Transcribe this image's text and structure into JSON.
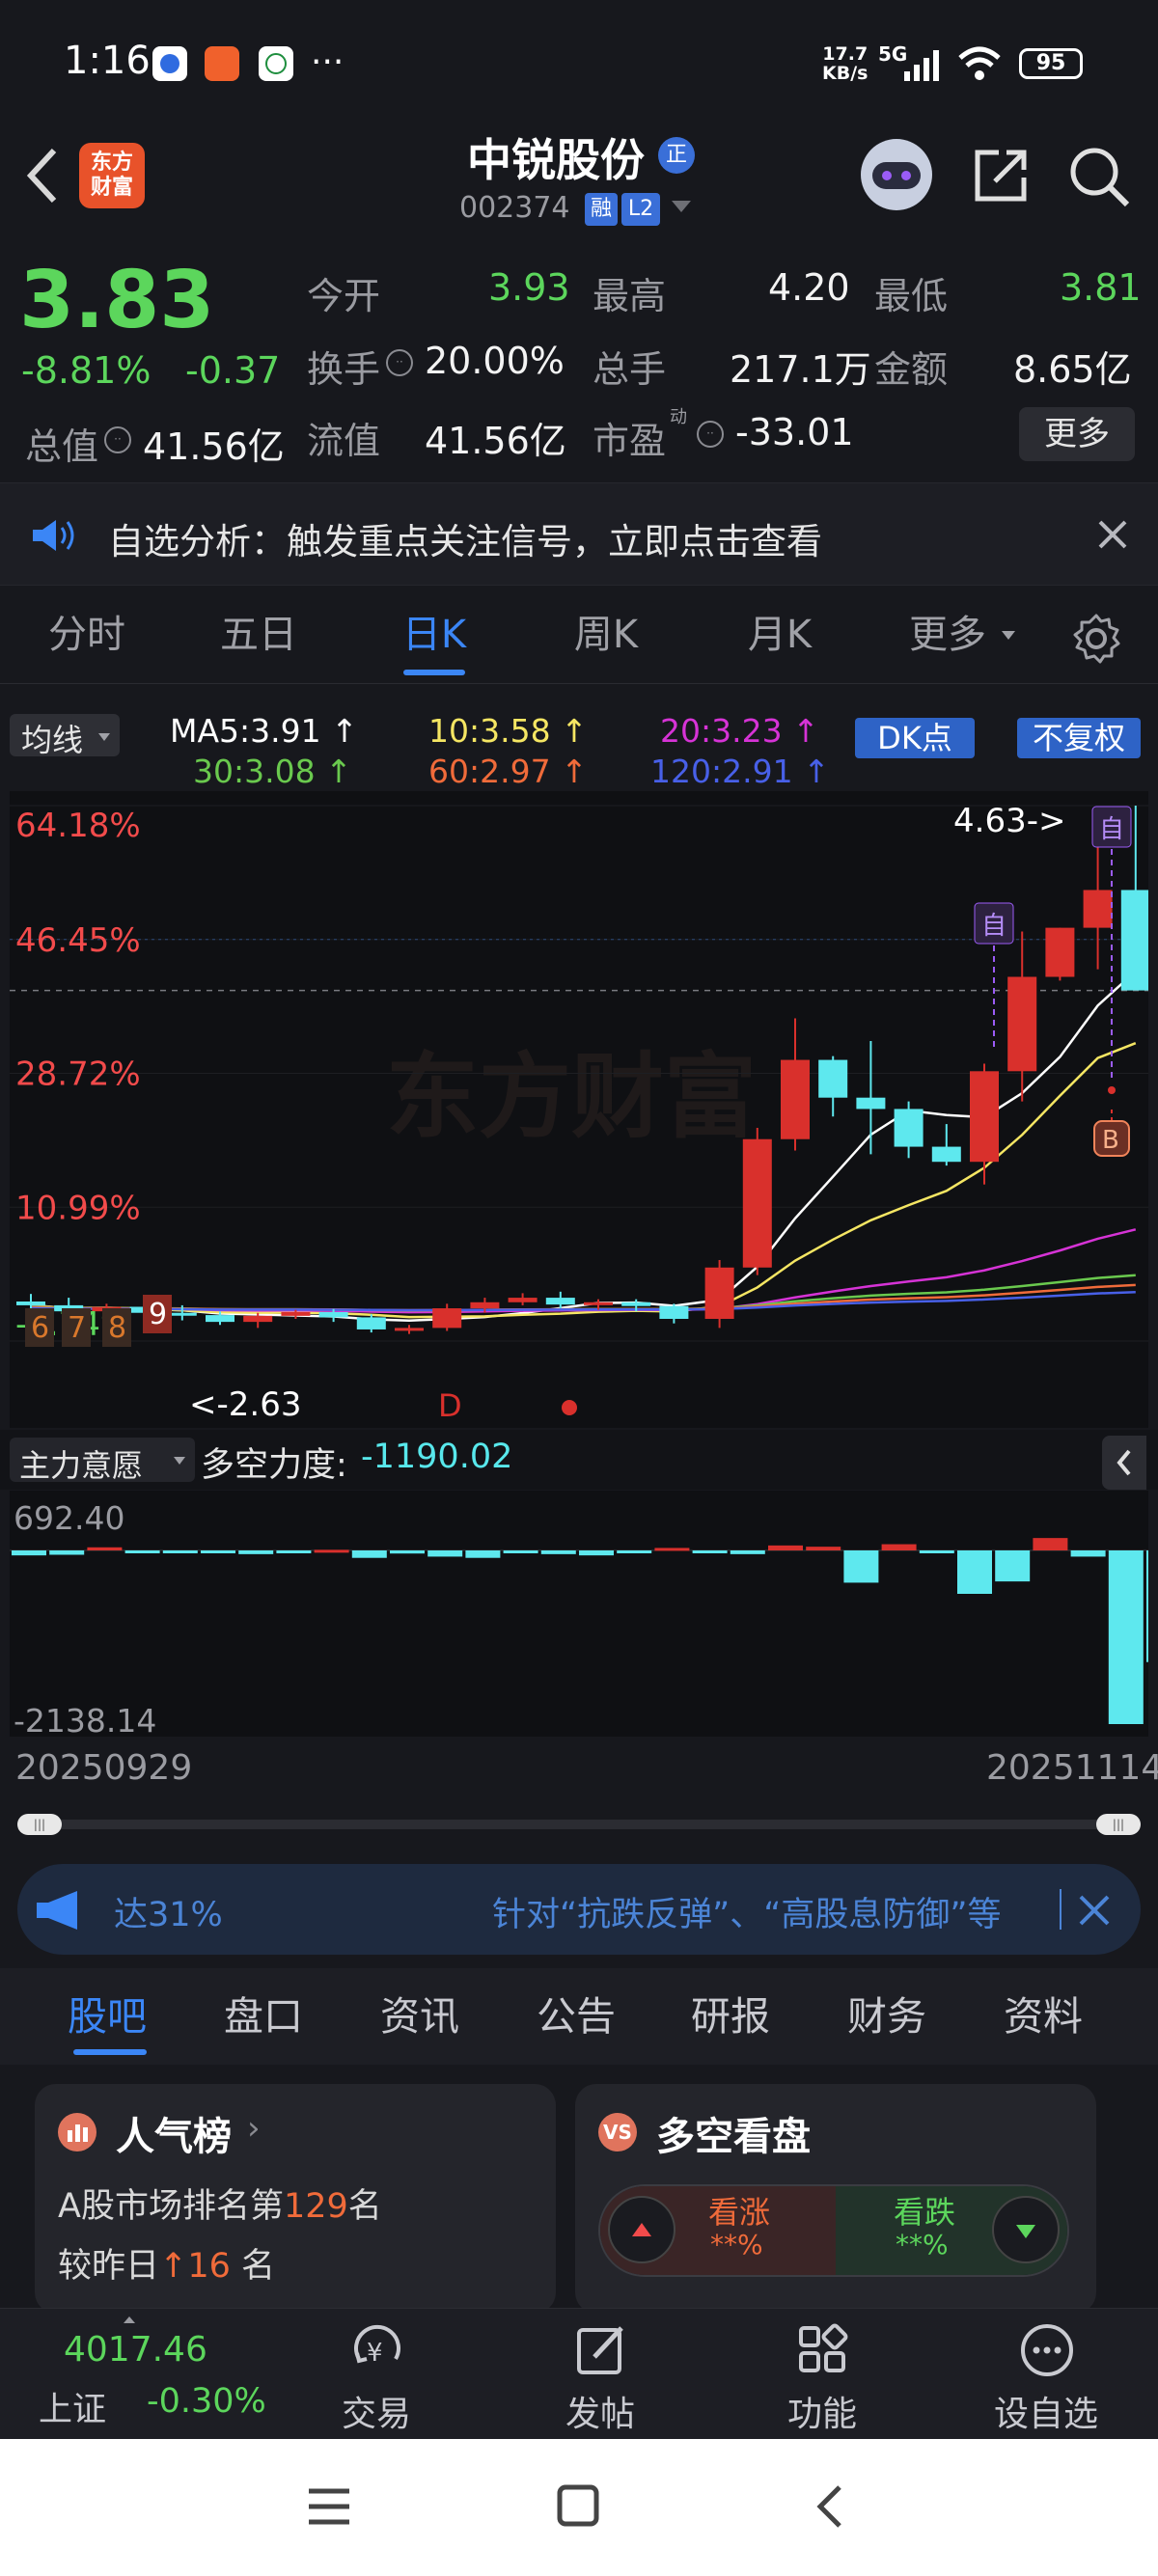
{
  "status_bar": {
    "time": "1:16",
    "net_speed": "17.7\nKB/s",
    "net_speed_top": "17.7",
    "net_speed_bottom": "KB/s",
    "signal": "5G",
    "battery": "95"
  },
  "header": {
    "logo_text_line1": "东方",
    "logo_text_line2": "财富",
    "stock_name": "中锐股份",
    "badge_zheng": "正",
    "stock_code": "002374",
    "badge_rong": "融",
    "badge_level": "L2"
  },
  "quote": {
    "price": "3.83",
    "change_pct": "-8.81%",
    "change": "-0.37",
    "open_label": "今开",
    "open": "3.93",
    "high_label": "最高",
    "high": "4.20",
    "low_label": "最低",
    "low": "3.81",
    "turnover_label": "换手",
    "turnover": "20.00%",
    "volume_label": "总手",
    "volume": "217.1万",
    "amount_label": "金额",
    "amount": "8.65亿",
    "mktcap_label": "总值",
    "mktcap": "41.56亿",
    "float_label": "流值",
    "float_cap": "41.56亿",
    "pe_label": "市盈",
    "pe_sup": "动",
    "pe": "-33.01",
    "more_button": "更多"
  },
  "notice": {
    "text": "自选分析：触发重点关注信号，立即点击查看"
  },
  "chart_tabs": {
    "items": [
      "分时",
      "五日",
      "日K",
      "周K",
      "月K",
      "更多"
    ],
    "active_index": 2
  },
  "ma": {
    "selector": "均线",
    "ma5": "MA5:3.91",
    "ma10": "10:3.58",
    "ma20": "20:3.23",
    "ma30": "30:3.08",
    "ma60": "60:2.97",
    "ma120": "120:2.91",
    "dk_button": "DK点",
    "fq_button": "不复权",
    "colors": {
      "ma5": "#ffffff",
      "ma10": "#f5e663",
      "ma20": "#d633d6",
      "ma30": "#6ac94e",
      "ma60": "#f06b3a",
      "ma120": "#4860e8"
    }
  },
  "chart_data": {
    "type": "candlestick",
    "y_axis_labels": [
      "64.18%",
      "46.45%",
      "28.72%",
      "10.99%",
      "-6.74%"
    ],
    "ylim_pct": [
      -6.74,
      64.18
    ],
    "annotations": {
      "high_marker": "4.63->",
      "low_marker": "<-2.63",
      "self_tag": "自",
      "buy_tag": "B",
      "d_tag": "D",
      "nine_turn_labels": [
        "6",
        "7",
        "8",
        "9"
      ]
    },
    "watermark": "东方财富",
    "candles_pct": [
      {
        "o": -1.5,
        "c": -2.0,
        "h": -0.5,
        "l": -4.0
      },
      {
        "o": -2.0,
        "c": -2.8,
        "h": -1.0,
        "l": -3.5
      },
      {
        "o": -2.8,
        "c": -2.2,
        "h": -1.8,
        "l": -4.2
      },
      {
        "o": -2.2,
        "c": -3.0,
        "h": -1.5,
        "l": -3.6
      },
      {
        "o": -3.0,
        "c": -3.3,
        "h": -2.0,
        "l": -4.0
      },
      {
        "o": -3.3,
        "c": -4.2,
        "h": -2.8,
        "l": -4.6
      },
      {
        "o": -4.2,
        "c": -3.4,
        "h": -3.0,
        "l": -5.0
      },
      {
        "o": -3.4,
        "c": -2.9,
        "h": -2.6,
        "l": -3.8
      },
      {
        "o": -2.9,
        "c": -3.6,
        "h": -2.5,
        "l": -4.2
      },
      {
        "o": -3.6,
        "c": -5.2,
        "h": -3.2,
        "l": -5.6
      },
      {
        "o": -5.2,
        "c": -5.0,
        "h": -4.6,
        "l": -5.8
      },
      {
        "o": -5.0,
        "c": -2.4,
        "h": -1.8,
        "l": -5.4
      },
      {
        "o": -2.4,
        "c": -1.6,
        "h": -1.0,
        "l": -3.0
      },
      {
        "o": -1.6,
        "c": -1.0,
        "h": -0.4,
        "l": -2.0
      },
      {
        "o": -1.0,
        "c": -1.9,
        "h": -0.2,
        "l": -2.4
      },
      {
        "o": -1.9,
        "c": -1.6,
        "h": -1.2,
        "l": -2.6
      },
      {
        "o": -1.6,
        "c": -2.1,
        "h": -1.2,
        "l": -2.8
      },
      {
        "o": -2.1,
        "c": -3.8,
        "h": -1.8,
        "l": -4.4
      },
      {
        "o": -3.8,
        "c": 3.0,
        "h": 4.0,
        "l": -5.0
      },
      {
        "o": 3.0,
        "c": 20.0,
        "h": 21.5,
        "l": 2.0
      },
      {
        "o": 20.0,
        "c": 30.5,
        "h": 36.0,
        "l": 18.5
      },
      {
        "o": 30.5,
        "c": 25.5,
        "h": 31.0,
        "l": 23.0
      },
      {
        "o": 25.5,
        "c": 24.0,
        "h": 33.0,
        "l": 18.0
      },
      {
        "o": 24.0,
        "c": 19.0,
        "h": 25.0,
        "l": 17.5
      },
      {
        "o": 19.0,
        "c": 17.0,
        "h": 22.0,
        "l": 16.5
      },
      {
        "o": 17.0,
        "c": 29.0,
        "h": 30.0,
        "l": 14.0
      },
      {
        "o": 29.0,
        "c": 41.5,
        "h": 47.5,
        "l": 25.0
      },
      {
        "o": 41.5,
        "c": 48.0,
        "h": 48.0,
        "l": 41.0
      },
      {
        "o": 48.0,
        "c": 53.0,
        "h": 61.0,
        "l": 42.5
      },
      {
        "o": 53.0,
        "c": 39.7,
        "h": 64.18,
        "l": 40.0
      }
    ]
  },
  "indicator": {
    "selector": "主力意愿",
    "label": "多空力度:",
    "value": "-1190.02",
    "max_label": "692.40",
    "min_label": "-2138.14",
    "bars": [
      -40,
      -35,
      25,
      -15,
      -20,
      -20,
      -30,
      -10,
      5,
      -60,
      -25,
      -50,
      -60,
      -20,
      -30,
      -40,
      -20,
      20,
      -5,
      -30,
      40,
      30,
      -260,
      50,
      -15,
      -350,
      -250,
      100,
      -50,
      -1400,
      -900
    ]
  },
  "dates": {
    "start": "20250929",
    "end": "20251114"
  },
  "ad": {
    "left": "达31%",
    "right": "针对“抗跌反弹”、“高股息防御”等"
  },
  "bottom_tabs": {
    "items": [
      "股吧",
      "盘口",
      "资讯",
      "公告",
      "研报",
      "财务",
      "资料"
    ],
    "active_index": 0
  },
  "cards": {
    "popular": {
      "title": "人气榜",
      "line1_pre": "A股市场排名第",
      "rank": "129",
      "line1_post": "名",
      "line2_pre": "较昨日",
      "delta": "16",
      "line2_post": "名"
    },
    "duokong": {
      "title": "多空看盘",
      "up_label": "看涨",
      "up_value": "**%",
      "down_label": "看跌",
      "down_value": "**%"
    }
  },
  "bottom_nav": {
    "index_value": "4017.46",
    "index_name": "上证",
    "index_change": "-0.30%",
    "items": [
      "交易",
      "发帖",
      "功能",
      "设自选"
    ]
  }
}
